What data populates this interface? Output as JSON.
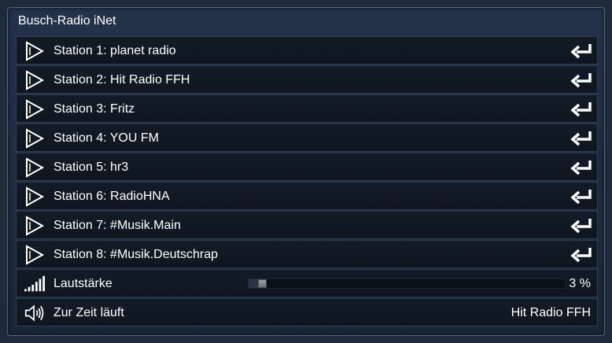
{
  "widget": {
    "title": "Busch-Radio iNet"
  },
  "stations": [
    {
      "label": "Station 1: planet radio"
    },
    {
      "label": "Station 2: Hit Radio FFH"
    },
    {
      "label": "Station 3: Fritz"
    },
    {
      "label": "Station 4: YOU FM"
    },
    {
      "label": "Station 5: hr3"
    },
    {
      "label": "Station 6: RadioHNA"
    },
    {
      "label": "Station 7: #Musik.Main"
    },
    {
      "label": "Station 8: #Musik.Deutschrap"
    }
  ],
  "volume": {
    "label": "Lautstärke",
    "value_text": "3 %",
    "level": 0.03,
    "icon": "volume-bars-icon"
  },
  "now_playing": {
    "label": "Zur Zeit läuft",
    "value": "Hit Radio FFH",
    "icon": "speaker-icon"
  },
  "icons": {
    "station": "play-icon",
    "action": "enter-icon"
  }
}
